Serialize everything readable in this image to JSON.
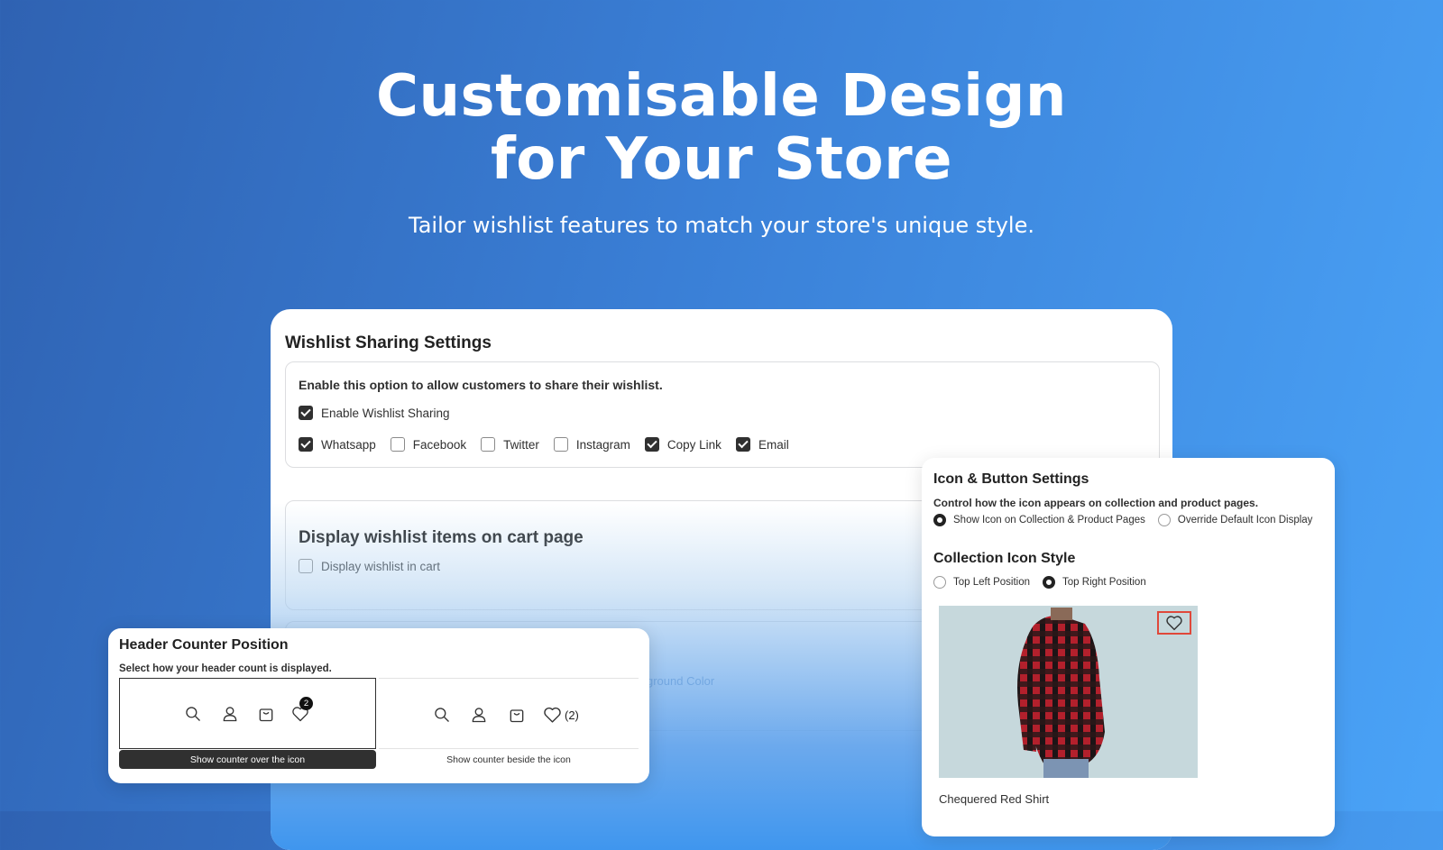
{
  "hero": {
    "title_line1": "Customisable Design",
    "title_line2": "for Your Store",
    "subtitle": "Tailor wishlist features to match your store's unique style."
  },
  "sharing": {
    "title": "Wishlist Sharing Settings",
    "description": "Enable this option to allow customers to share their wishlist.",
    "enable_label": "Enable Wishlist Sharing",
    "enable_checked": true,
    "channels": [
      {
        "label": "Whatsapp",
        "checked": true
      },
      {
        "label": "Facebook",
        "checked": false
      },
      {
        "label": "Twitter",
        "checked": false
      },
      {
        "label": "Instagram",
        "checked": false
      },
      {
        "label": "Copy Link",
        "checked": true
      },
      {
        "label": "Email",
        "checked": true
      }
    ]
  },
  "cart": {
    "title": "Display wishlist items on cart page",
    "checkbox_label": "Display wishlist in cart",
    "checked": false,
    "partial_text": "ground Color"
  },
  "icon_settings": {
    "title": "Icon & Button Settings",
    "description": "Control how the icon appears on collection and product pages.",
    "options": [
      {
        "label": "Show Icon on Collection & Product Pages",
        "selected": true
      },
      {
        "label": "Override Default Icon Display",
        "selected": false
      }
    ],
    "collection_title": "Collection Icon Style",
    "positions": [
      {
        "label": "Top Left Position",
        "selected": false
      },
      {
        "label": "Top Right Position",
        "selected": true
      }
    ],
    "product_name": "Chequered Red Shirt",
    "highlight_color": "#e0483a"
  },
  "counter": {
    "title": "Header Counter Position",
    "description": "Select how your header count is displayed.",
    "badge_count": "2",
    "beside_count": "(2)",
    "option_over": "Show counter over the icon",
    "option_beside": "Show counter beside the icon",
    "icons": [
      "search-icon",
      "user-icon",
      "bag-icon",
      "heart-icon"
    ]
  },
  "colors": {
    "bg_start": "#2f62b2",
    "bg_end": "#4aa3f7",
    "checkbox_on": "#303030"
  }
}
